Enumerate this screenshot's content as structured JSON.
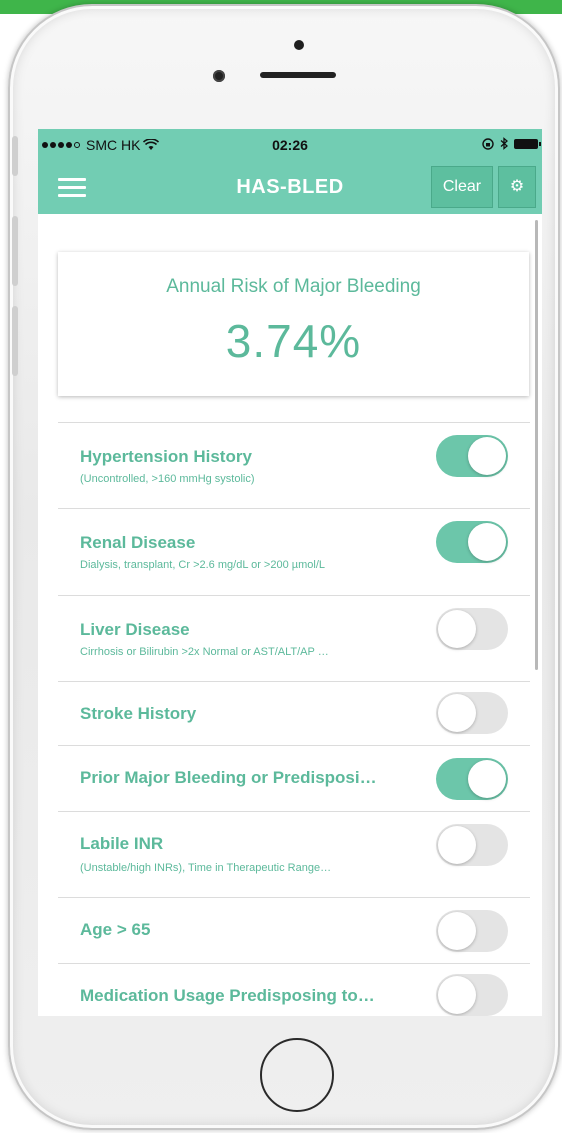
{
  "status_bar": {
    "carrier": "SMC HK",
    "time": "02:26"
  },
  "navbar": {
    "title": "HAS-BLED",
    "clear_label": "Clear",
    "gear_glyph": "⚙"
  },
  "result": {
    "label": "Annual Risk of Major Bleeding",
    "value": "3.74%"
  },
  "criteria": [
    {
      "title": "Hypertension History",
      "subtitle": "(Uncontrolled, >160 mmHg systolic)",
      "on": true
    },
    {
      "title": "Renal Disease",
      "subtitle": "Dialysis, transplant, Cr >2.6 mg/dL or >200 µmol/L",
      "on": true
    },
    {
      "title": "Liver Disease",
      "subtitle": "Cirrhosis or Bilirubin >2x Normal or AST/ALT/AP …",
      "on": false
    },
    {
      "title": "Stroke History",
      "subtitle": "",
      "on": false
    },
    {
      "title": "Prior Major Bleeding or Predisposi…",
      "subtitle": "",
      "on": true
    },
    {
      "title": "Labile INR",
      "subtitle": "(Unstable/high INRs), Time in Therapeutic Range…",
      "on": false
    },
    {
      "title": "Age > 65",
      "subtitle": "",
      "on": false
    },
    {
      "title": "Medication Usage Predisposing to…",
      "subtitle": "",
      "on": false
    }
  ],
  "colors": {
    "accent": "#72cdb3",
    "text_accent": "#5cb99b",
    "toggle_on": "#6cc6aa",
    "toggle_off": "#e4e4e4"
  }
}
